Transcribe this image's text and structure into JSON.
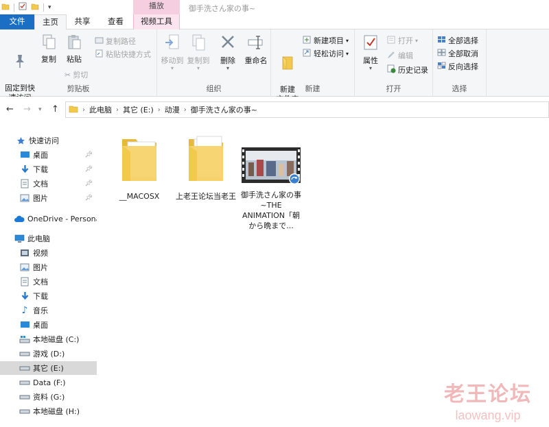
{
  "titlebar": {
    "context_group": "播放",
    "window_title": "御手洗さん家の事~"
  },
  "tabs": [
    "文件",
    "主页",
    "共享",
    "查看",
    "视频工具"
  ],
  "ribbon": {
    "clipboard": {
      "label": "剪贴板",
      "pin_quick_access": "固定到快\n速访问",
      "copy": "复制",
      "paste": "粘贴",
      "copy_path": "复制路径",
      "paste_shortcut": "粘贴快捷方式",
      "cut": "剪切"
    },
    "organize": {
      "label": "组织",
      "move_to": "移动到",
      "copy_to": "复制到",
      "delete": "删除",
      "rename": "重命名"
    },
    "new": {
      "label": "新建",
      "new_folder": "新建\n文件夹",
      "new_item": "新建项目",
      "easy_access": "轻松访问"
    },
    "open": {
      "label": "打开",
      "properties": "属性",
      "open": "打开",
      "edit": "编辑",
      "history": "历史记录"
    },
    "select": {
      "label": "选择",
      "select_all": "全部选择",
      "select_none": "全部取消",
      "invert": "反向选择"
    }
  },
  "address": {
    "crumbs": [
      "此电脑",
      "其它 (E:)",
      "动漫",
      "御手洗さん家の事~"
    ]
  },
  "navpane": {
    "quick_access": "快速访问",
    "quick_items": [
      "桌面",
      "下载",
      "文档",
      "图片"
    ],
    "onedrive": "OneDrive - Persona",
    "this_pc": "此电脑",
    "pc_items": [
      "视频",
      "图片",
      "文档",
      "下载",
      "音乐",
      "桌面",
      "本地磁盘 (C:)",
      "游戏 (D:)",
      "其它 (E:)",
      "Data (F:)",
      "资料 (G:)",
      "本地磁盘 (H:)"
    ],
    "selected": "其它 (E:)"
  },
  "files": [
    {
      "name": "__MACOSX",
      "type": "folder"
    },
    {
      "name": "上老王论坛当老王",
      "type": "folder"
    },
    {
      "name": "御手洗さん家の事~THE ANIMATION「朝から晩まで...",
      "type": "video"
    }
  ],
  "watermark": {
    "main": "老王论坛",
    "sub": "laowang.vip"
  },
  "colors": {
    "file_tab": "#1a6fc4",
    "context_tab": "#f5cfe0",
    "folder": "#f2c94c",
    "selection": "#d9d9d9"
  }
}
